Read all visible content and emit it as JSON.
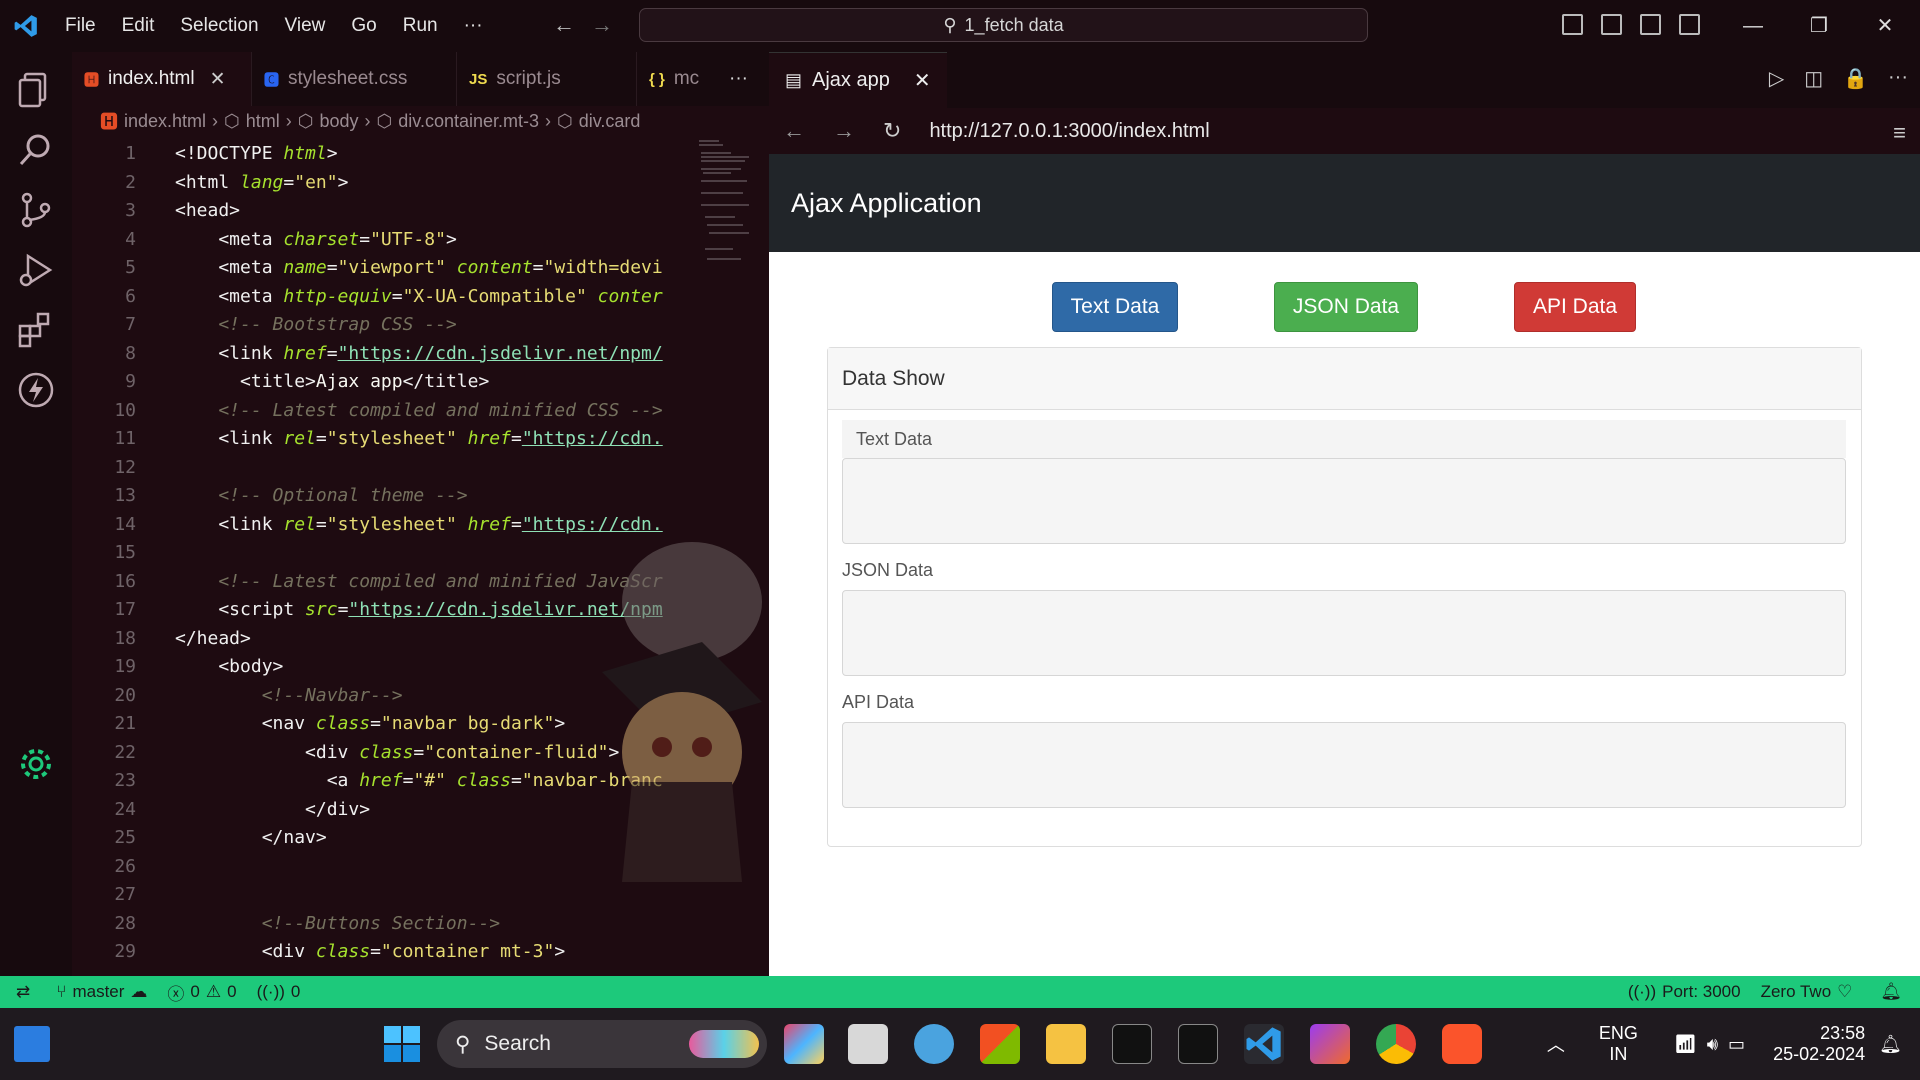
{
  "titlebar": {
    "menu": [
      "File",
      "Edit",
      "Selection",
      "View",
      "Go",
      "Run",
      "···"
    ],
    "search_text": "1_fetch data"
  },
  "editor_tabs": [
    {
      "icon": "5",
      "label": "index.html",
      "active": true,
      "color": "#e44d26"
    },
    {
      "icon": "3",
      "label": "stylesheet.css",
      "active": false,
      "color": "#2965f1"
    },
    {
      "icon": "JS",
      "label": "script.js",
      "active": false,
      "color": "#f0db4f"
    },
    {
      "icon": "{ }",
      "label": "mc",
      "active": false,
      "color": "#f0db4f"
    }
  ],
  "more_tabs": "···",
  "breadcrumb": [
    "index.html",
    "html",
    "body",
    "div.container.mt-3",
    "div.card"
  ],
  "code_lines": [
    [
      [
        "tag",
        "<!DOCTYPE "
      ],
      [
        "attr",
        "html"
      ],
      [
        "tag",
        ">"
      ]
    ],
    [
      [
        "tag",
        "<html "
      ],
      [
        "attr",
        "lang"
      ],
      [
        "tag",
        "="
      ],
      [
        "str",
        "\"en\""
      ],
      [
        "tag",
        ">"
      ]
    ],
    [
      [
        "tag",
        "<head>"
      ]
    ],
    [
      [
        "tag",
        "    <meta "
      ],
      [
        "attr",
        "charset"
      ],
      [
        "tag",
        "="
      ],
      [
        "str",
        "\"UTF-8\""
      ],
      [
        "tag",
        ">"
      ]
    ],
    [
      [
        "tag",
        "    <meta "
      ],
      [
        "attr",
        "name"
      ],
      [
        "tag",
        "="
      ],
      [
        "str",
        "\"viewport\" "
      ],
      [
        "attr",
        "content"
      ],
      [
        "tag",
        "="
      ],
      [
        "str",
        "\"width=devi"
      ]
    ],
    [
      [
        "tag",
        "    <meta "
      ],
      [
        "attr",
        "http-equiv"
      ],
      [
        "tag",
        "="
      ],
      [
        "str",
        "\"X-UA-Compatible\" "
      ],
      [
        "attr",
        "conter"
      ]
    ],
    [
      [
        "cmt",
        "    <!-- Bootstrap CSS -->"
      ]
    ],
    [
      [
        "tag",
        "    <link "
      ],
      [
        "attr",
        "href"
      ],
      [
        "tag",
        "="
      ],
      [
        "url",
        "\"https://cdn.jsdelivr.net/npm/"
      ]
    ],
    [
      [
        "tag",
        "      <title>"
      ],
      [
        "plain",
        "Ajax app"
      ],
      [
        "tag",
        "</title>"
      ]
    ],
    [
      [
        "cmt",
        "    <!-- Latest compiled and minified CSS -->"
      ]
    ],
    [
      [
        "tag",
        "    <link "
      ],
      [
        "attr",
        "rel"
      ],
      [
        "tag",
        "="
      ],
      [
        "str",
        "\"stylesheet\" "
      ],
      [
        "attr",
        "href"
      ],
      [
        "tag",
        "="
      ],
      [
        "url",
        "\"https://cdn."
      ]
    ],
    [],
    [
      [
        "cmt",
        "    <!-- Optional theme -->"
      ]
    ],
    [
      [
        "tag",
        "    <link "
      ],
      [
        "attr",
        "rel"
      ],
      [
        "tag",
        "="
      ],
      [
        "str",
        "\"stylesheet\" "
      ],
      [
        "attr",
        "href"
      ],
      [
        "tag",
        "="
      ],
      [
        "url",
        "\"https://cdn."
      ]
    ],
    [],
    [
      [
        "cmt",
        "    <!-- Latest compiled and minified JavaScr"
      ]
    ],
    [
      [
        "tag",
        "    <script "
      ],
      [
        "attr",
        "src"
      ],
      [
        "tag",
        "="
      ],
      [
        "url",
        "\"https://cdn.jsdelivr.net/npm"
      ]
    ],
    [
      [
        "tag",
        "</head>"
      ]
    ],
    [
      [
        "tag",
        "    <body>"
      ]
    ],
    [
      [
        "cmt",
        "        <!--Navbar-->"
      ]
    ],
    [
      [
        "tag",
        "        <nav "
      ],
      [
        "attr",
        "class"
      ],
      [
        "tag",
        "="
      ],
      [
        "str",
        "\"navbar bg-dark\""
      ],
      [
        "tag",
        ">"
      ]
    ],
    [
      [
        "tag",
        "            <div "
      ],
      [
        "attr",
        "class"
      ],
      [
        "tag",
        "="
      ],
      [
        "str",
        "\"container-fluid\""
      ],
      [
        "tag",
        ">"
      ]
    ],
    [
      [
        "tag",
        "              <a "
      ],
      [
        "attr",
        "href"
      ],
      [
        "tag",
        "="
      ],
      [
        "str",
        "\"#\" "
      ],
      [
        "attr",
        "class"
      ],
      [
        "tag",
        "="
      ],
      [
        "str",
        "\"navbar-branc"
      ]
    ],
    [
      [
        "tag",
        "            </div>"
      ]
    ],
    [
      [
        "tag",
        "        </nav>"
      ]
    ],
    [],
    [],
    [
      [
        "cmt",
        "        <!--Buttons Section-->"
      ]
    ],
    [
      [
        "tag",
        "        <div "
      ],
      [
        "attr",
        "class"
      ],
      [
        "tag",
        "="
      ],
      [
        "str",
        "\"container mt-3\""
      ],
      [
        "tag",
        ">"
      ]
    ]
  ],
  "preview": {
    "tab_label": "Ajax app",
    "url": "http://127.0.0.1:3000/index.html",
    "navbar_brand": "Ajax Application",
    "buttons": {
      "text": "Text Data",
      "json": "JSON Data",
      "api": "API Data"
    },
    "card_header": "Data Show",
    "sections": {
      "text": "Text Data",
      "json": "JSON Data",
      "api": "API Data"
    }
  },
  "statusbar": {
    "branch": "master",
    "errors": "0",
    "warnings": "0",
    "ports": "0",
    "port": "Port: 3000",
    "theme": "Zero Two"
  },
  "taskbar": {
    "search": "Search",
    "lang1": "ENG",
    "lang2": "IN",
    "time": "23:58",
    "date": "25-02-2024"
  },
  "colors": {
    "accent": "#1dc97b",
    "editor_bg": "#1e0b11",
    "navbar": "#212529"
  }
}
